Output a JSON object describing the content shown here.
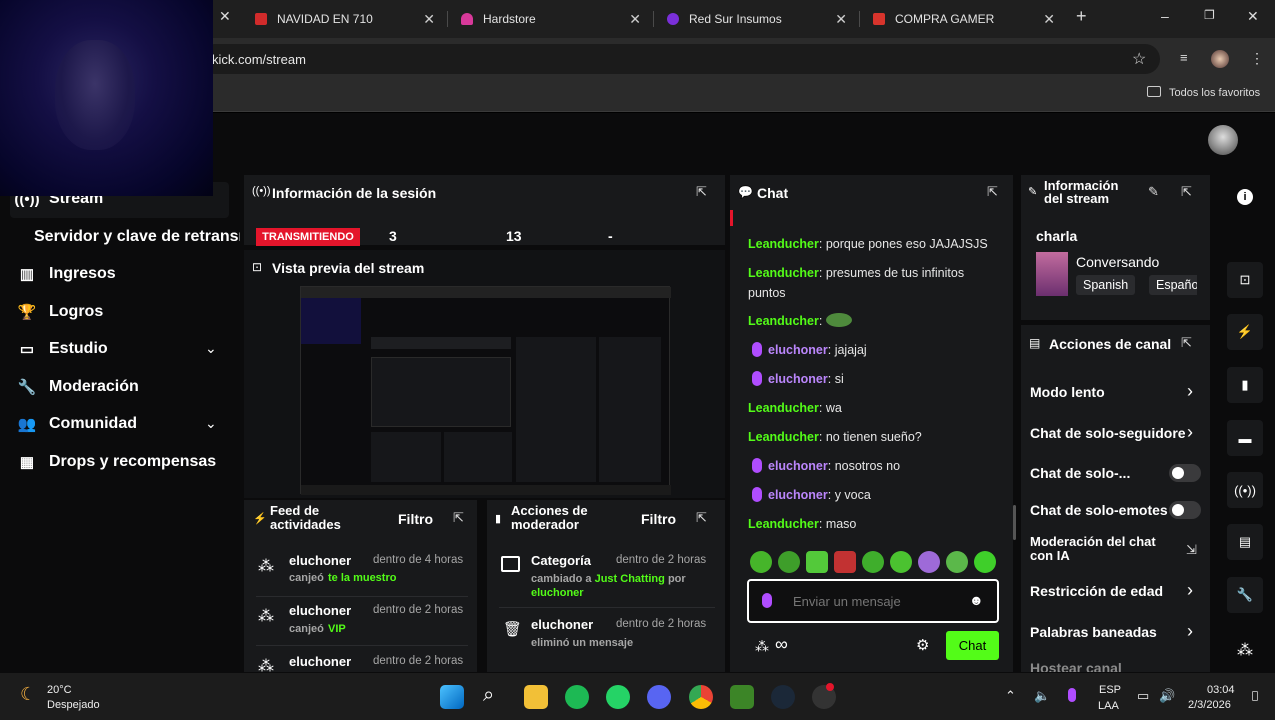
{
  "browser": {
    "tabs": [
      {
        "label": "NAVIDAD EN 710",
        "color": "#d12b2b"
      },
      {
        "label": "Hardstore",
        "color": "#d8399a"
      },
      {
        "label": "Red Sur Insumos",
        "color": "#7a2fd9"
      },
      {
        "label": "COMPRA GAMER",
        "color": "#d8342c"
      }
    ],
    "url": "kick.com/stream",
    "bookmarks_label": "Todos los favoritos"
  },
  "nav": {
    "items": [
      {
        "label": "Stream",
        "icon": "broadcast-icon"
      },
      {
        "label": "Servidor y clave de retransmisión",
        "icon": ""
      },
      {
        "label": "Ingresos",
        "icon": "revenue-icon"
      },
      {
        "label": "Logros",
        "icon": "trophy-icon"
      },
      {
        "label": "Estudio",
        "icon": "studio-icon"
      },
      {
        "label": "Moderación",
        "icon": "wrench-icon"
      },
      {
        "label": "Comunidad",
        "icon": "community-icon"
      },
      {
        "label": "Drops y recompensas",
        "icon": "drops-icon"
      }
    ]
  },
  "session": {
    "title": "Información de la sesión",
    "status": "TRANSMITIENDO",
    "status_color": "#e4152b",
    "stat1": "3",
    "stat2": "13",
    "stat3": "-"
  },
  "preview": {
    "title": "Vista previa del stream"
  },
  "feed": {
    "title": "Feed de actividades",
    "filter": "Filtro",
    "items": [
      {
        "user": "eluchoner",
        "time": "dentro de 4 horas",
        "action": "canjeó",
        "reward": "te la muestro"
      },
      {
        "user": "eluchoner",
        "time": "dentro de 2 horas",
        "action": "canjeó",
        "reward": "VIP"
      },
      {
        "user": "eluchoner",
        "time": "dentro de 2 horas",
        "action": "",
        "reward": ""
      }
    ]
  },
  "modactions": {
    "title": "Acciones de moderador",
    "filter": "Filtro",
    "items": [
      {
        "title": "Categoría",
        "time": "dentro de 2 horas",
        "pre": "cambiado a",
        "target": "Just Chatting",
        "mid": "por",
        "user": "eluchoner"
      },
      {
        "title": "eluchoner",
        "time": "dentro de 2 horas",
        "text": "eliminó un mensaje"
      }
    ]
  },
  "chat": {
    "title": "Chat",
    "messages": [
      {
        "user": "Leanducher",
        "text": "porque pones eso JAJAJSJS",
        "mod": false
      },
      {
        "user": "Leanducher",
        "text": "presumes de tus infinitos puntos",
        "mod": false
      },
      {
        "user": "Leanducher",
        "text": "",
        "mod": false
      },
      {
        "user": "eluchoner",
        "text": "jajajaj",
        "mod": true
      },
      {
        "user": "eluchoner",
        "text": "si",
        "mod": true
      },
      {
        "user": "Leanducher",
        "text": "wa",
        "mod": false
      },
      {
        "user": "Leanducher",
        "text": "no tienen sueño?",
        "mod": false
      },
      {
        "user": "eluchoner",
        "text": "nosotros no",
        "mod": true
      },
      {
        "user": "eluchoner",
        "text": "y voca",
        "mod": true
      },
      {
        "user": "Leanducher",
        "text": "maso",
        "mod": false
      }
    ],
    "placeholder": "Enviar un mensaje",
    "send": "Chat",
    "points": "∞"
  },
  "streaminfo": {
    "title": "Información del stream",
    "stream_title": "charla",
    "category": "Conversando",
    "tags": [
      "Spanish",
      "Español"
    ]
  },
  "channel": {
    "title": "Acciones de canal",
    "rows": [
      {
        "label": "Modo lento",
        "control": "chevron"
      },
      {
        "label": "Chat de solo-seguidore",
        "control": "chevron"
      },
      {
        "label": "Chat de solo-...",
        "control": "toggle"
      },
      {
        "label": "Chat de solo-emotes",
        "control": "toggle"
      },
      {
        "label": "Moderación del chat con IA",
        "control": "external"
      },
      {
        "label": "Restricción de edad",
        "control": "chevron"
      },
      {
        "label": "Palabras baneadas",
        "control": "chevron"
      },
      {
        "label": "Hostear canal",
        "control": "none"
      }
    ]
  },
  "taskbar": {
    "temp": "20°C",
    "weather": "Despejado",
    "lang1": "ESP",
    "lang2": "LAA",
    "time": "03:04",
    "date": "2/3/2026"
  },
  "colors": {
    "accent": "#53fc18",
    "panel": "#18191b",
    "page": "#0b0b0c"
  }
}
